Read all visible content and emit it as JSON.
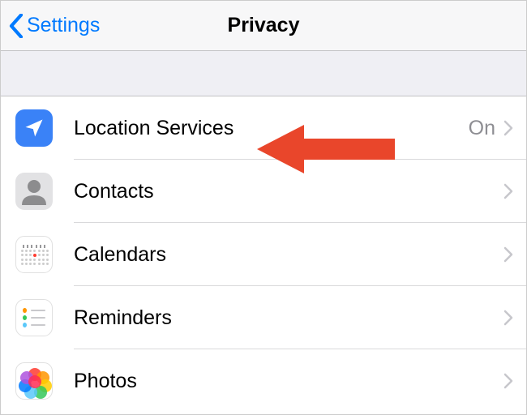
{
  "nav": {
    "back_label": "Settings",
    "title": "Privacy"
  },
  "rows": [
    {
      "icon": "location-icon",
      "label": "Location Services",
      "status": "On"
    },
    {
      "icon": "contacts-icon",
      "label": "Contacts",
      "status": ""
    },
    {
      "icon": "calendars-icon",
      "label": "Calendars",
      "status": ""
    },
    {
      "icon": "reminders-icon",
      "label": "Reminders",
      "status": ""
    },
    {
      "icon": "photos-icon",
      "label": "Photos",
      "status": ""
    }
  ],
  "colors": {
    "tint": "#007aff",
    "arrow": "#e9462b"
  }
}
